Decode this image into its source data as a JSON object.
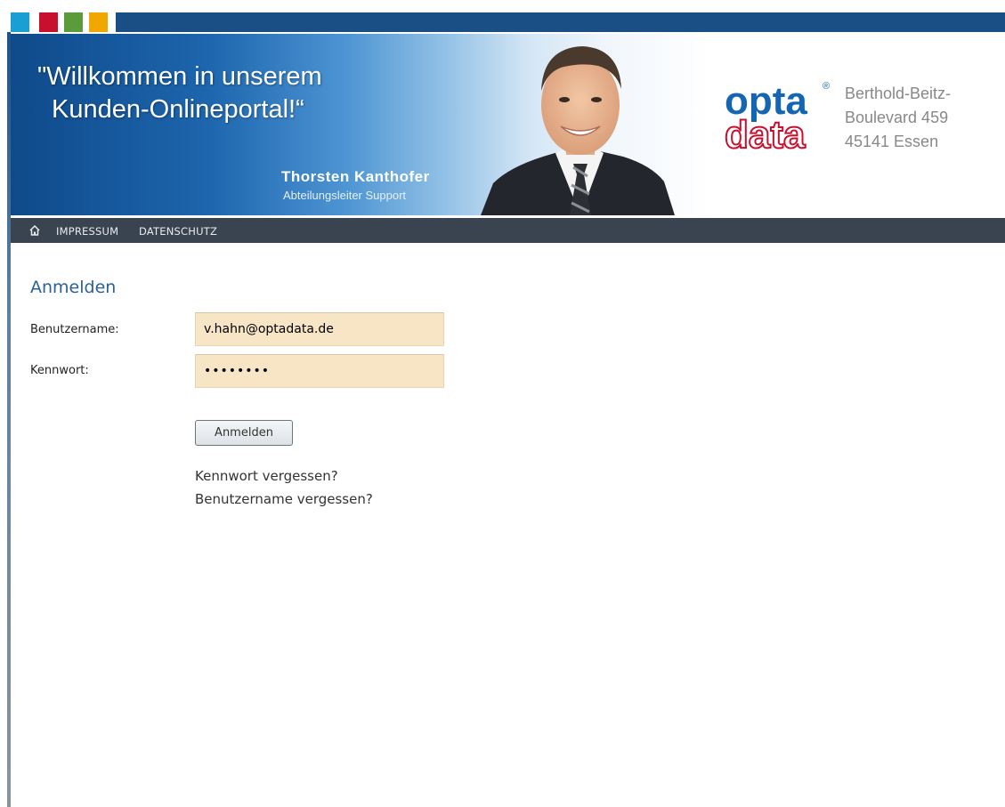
{
  "colors": {
    "swatches": [
      "#1a9fd4",
      "#c8102e",
      "#5a9b3a",
      "#f0a800"
    ],
    "top_bar": "#1a4f86",
    "nav_bar": "#3a4450",
    "title": "#2b6199",
    "field_bg": "#f8e5c6",
    "logo_blue": "#1466b3",
    "logo_red": "#c8102e"
  },
  "banner": {
    "quote_line1": "\"Willkommen in unserem",
    "quote_line2": "Kunden-Onlineportal!“",
    "person_name": "Thorsten Kanthofer",
    "person_title": "Abteilungsleiter Support",
    "logo_top": "opta",
    "logo_bottom": "data",
    "logo_mark": "®",
    "address": [
      "Berthold-Beitz-",
      "Boulevard 459",
      "45141 Essen"
    ]
  },
  "nav": {
    "home_icon": "home-icon",
    "items": [
      {
        "label": "IMPRESSUM"
      },
      {
        "label": "DATENSCHUTZ"
      }
    ]
  },
  "login": {
    "title": "Anmelden",
    "username_label": "Benutzername:",
    "username_value": "v.hahn@optadata.de",
    "password_label": "Kennwort:",
    "password_value": "********",
    "submit_label": "Anmelden",
    "forgot_password": "Kennwort vergessen?",
    "forgot_username": "Benutzername vergessen?"
  }
}
